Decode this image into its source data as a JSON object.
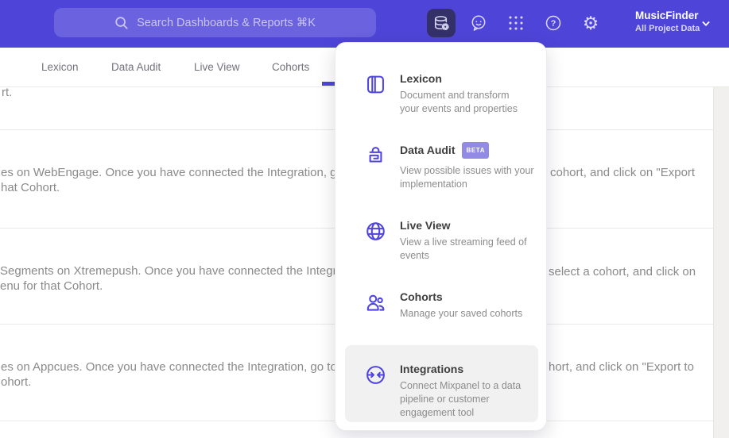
{
  "header": {
    "search_placeholder": "Search Dashboards & Reports ⌘K",
    "project_name": "MusicFinder",
    "project_subtitle": "All Project Data",
    "settings_glyph": "⚙",
    "help_glyph": "?",
    "icons": [
      "data-management-icon",
      "feedback-smiley-icon",
      "apps-grid-icon",
      "help-icon",
      "settings-gear-icon",
      "chevron-down-icon"
    ],
    "accent_color": "#4e45d8"
  },
  "tabs": {
    "items": [
      "Lexicon",
      "Data Audit",
      "Live View",
      "Cohorts"
    ]
  },
  "menu": {
    "items": [
      {
        "title": "Lexicon",
        "icon": "lexicon-book-icon",
        "desc": "Document and transform\nyour events and properties"
      },
      {
        "title": "Data Audit",
        "icon": "data-audit-lock-icon",
        "badge": "BETA",
        "desc": "View possible issues with your\nimplementation"
      },
      {
        "title": "Live View",
        "icon": "live-view-globe-icon",
        "desc": "View a live streaming feed of\nevents"
      },
      {
        "title": "Cohorts",
        "icon": "cohorts-people-icon",
        "desc": "Manage your saved cohorts"
      },
      {
        "title": "Integrations",
        "icon": "integrations-sync-icon",
        "desc": "Connect Mixpanel to a data\npipeline or customer\nengagement tool",
        "highlighted": true
      }
    ],
    "badge_color": "#938ae6",
    "icon_color": "#4f44e0"
  },
  "content": {
    "rows": [
      {
        "l1": "rt."
      },
      {
        "l1": "es on WebEngage. Once you have connected the Integration, go to the",
        "l2": "hat Cohort.",
        "r1": "cohort, and click on \"Export"
      },
      {
        "l1": "Segments on Xtremepush. Once you have connected the Integration,",
        "l2": "enu for that Cohort.",
        "r1": "select a cohort, and click on"
      },
      {
        "l1": "es on Appcues. Once you have connected the Integration, go to the M",
        "l2": "ohort.",
        "r1": "hort, and click on \"Export to"
      }
    ]
  }
}
